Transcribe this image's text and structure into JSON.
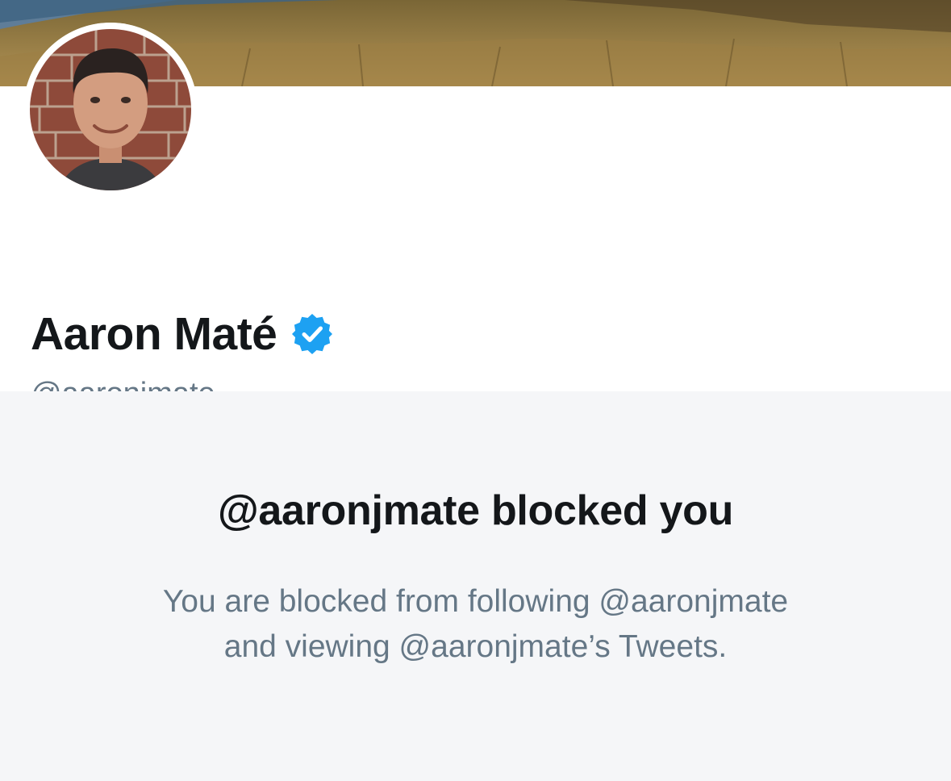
{
  "profile": {
    "display_name": "Aaron Maté",
    "handle": "@aaronjmate",
    "verified": true,
    "avatar_icon": "avatar-photo",
    "banner_icon": "banner-landscape-photo"
  },
  "blocked": {
    "title": "@aaronjmate blocked you",
    "message_line_1": "You are blocked from following @aaronjmate",
    "message_line_2": "and viewing @aaronjmate’s Tweets."
  },
  "colors": {
    "verified_badge": "#1da1f2",
    "primary_text": "#14171a",
    "secondary_text": "#657786",
    "panel_background": "#f5f6f8"
  }
}
